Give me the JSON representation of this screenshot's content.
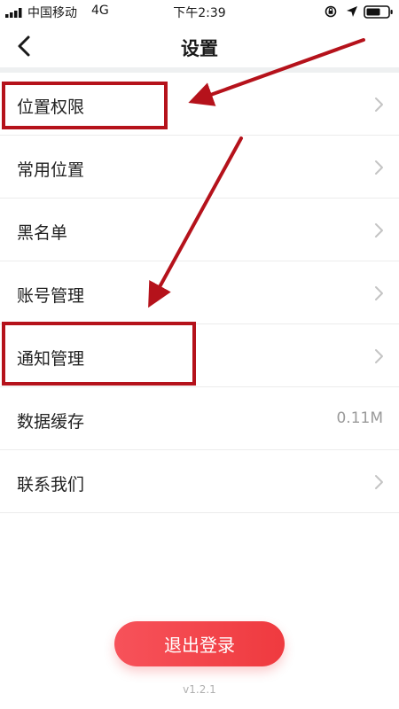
{
  "status_bar": {
    "carrier": "中国移动",
    "network": "4G",
    "time": "下午2:39"
  },
  "header": {
    "title": "设置"
  },
  "settings": {
    "items": [
      {
        "label": "位置权限",
        "value": ""
      },
      {
        "label": "常用位置",
        "value": ""
      },
      {
        "label": "黑名单",
        "value": ""
      },
      {
        "label": "账号管理",
        "value": ""
      },
      {
        "label": "通知管理",
        "value": ""
      },
      {
        "label": "数据缓存",
        "value": "0.11M"
      },
      {
        "label": "联系我们",
        "value": ""
      }
    ]
  },
  "logout": {
    "label": "退出登录"
  },
  "version": "v1.2.1",
  "colors": {
    "accent": "#ef3a3f",
    "annotation": "#b5121b",
    "divider": "#eef0f1"
  },
  "icons": {
    "back": "chevron-left-icon",
    "row": "chevron-right-icon",
    "signal": "signal-icon",
    "lock": "orientation-lock-icon",
    "location": "location-arrow-icon",
    "battery": "battery-icon"
  }
}
